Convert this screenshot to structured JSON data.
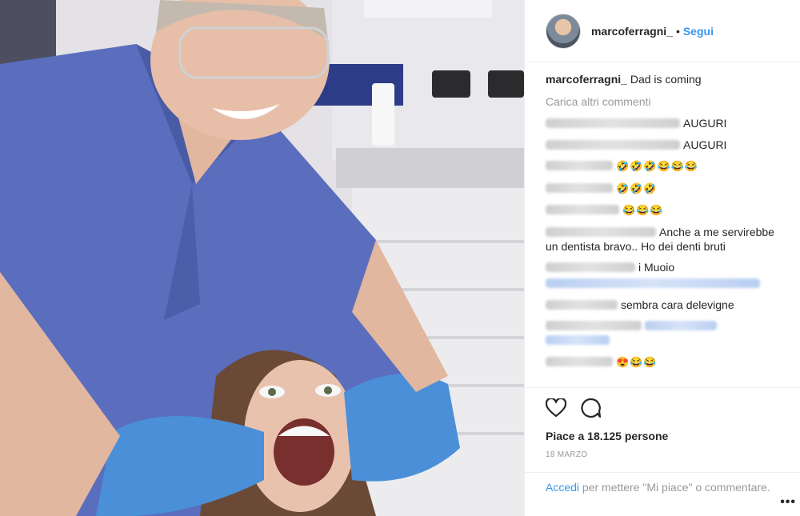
{
  "post": {
    "username": "marcoferragni_",
    "separator": "•",
    "follow_label": "Segui",
    "caption_user": "marcoferragni_",
    "caption_text": "Dad is coming",
    "load_more": "Carica altri commenti",
    "comments": [
      {
        "text": "AUGURI"
      },
      {
        "text": "AUGURI"
      },
      {
        "text": "🤣🤣🤣😂😂😂"
      },
      {
        "text": "🤣🤣🤣"
      },
      {
        "text": "😂😂😂"
      },
      {
        "text": "Anche a me servirebbe un dentista bravo.. Ho dei denti bruti"
      },
      {
        "text": "i Muoio"
      },
      {
        "text": "sembra cara delevigne"
      },
      {
        "text": ""
      },
      {
        "text": "😍😂😂"
      }
    ],
    "likes": "Piace a 18.125 persone",
    "date": "18 MARZO",
    "login_link": "Accedi",
    "login_text": " per mettere \"Mi piace\" o commentare.",
    "more_icon": "•••"
  },
  "icons": {
    "like": "heart-icon",
    "comment": "comment-bubble-icon"
  },
  "colors": {
    "link": "#3897f0",
    "muted": "#999999",
    "text": "#262626",
    "scrubs": "#5a6ebd",
    "glove": "#4a8fd8"
  }
}
